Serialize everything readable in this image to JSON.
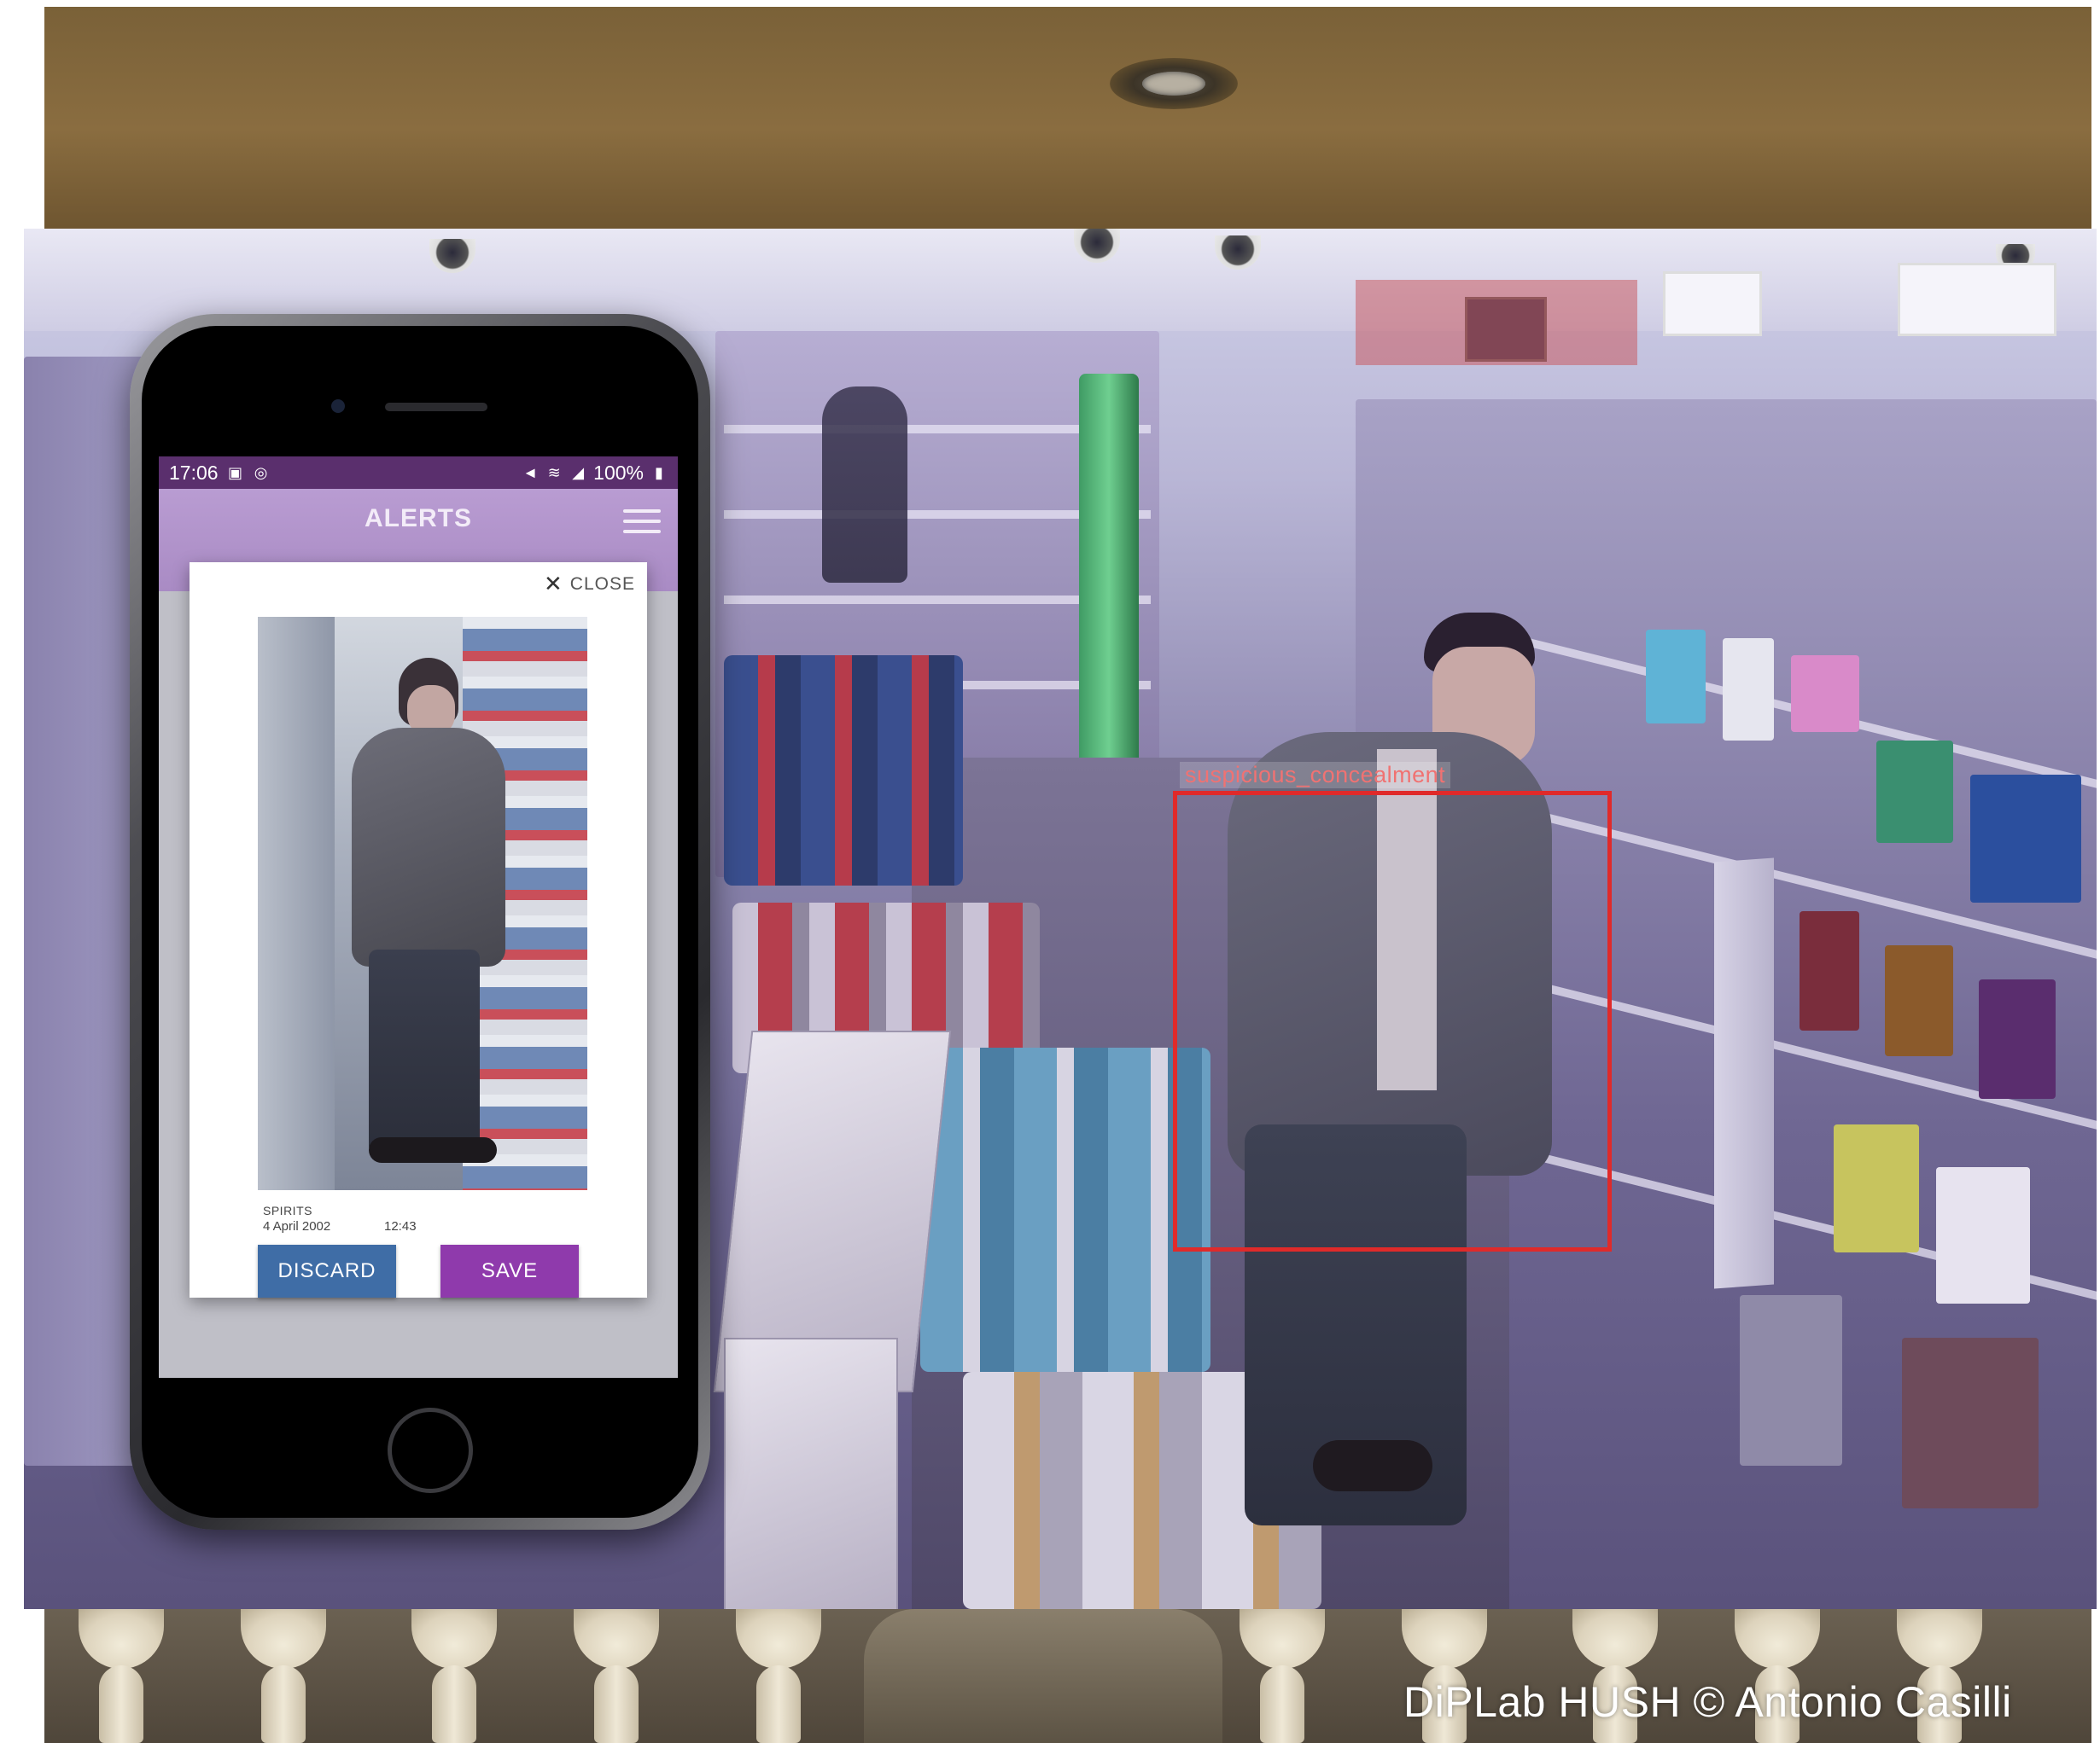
{
  "phone": {
    "status_bar": {
      "time": "17:06",
      "battery": "100%",
      "left_icons": [
        "image-icon",
        "sync-icon"
      ],
      "right_icons": [
        "mute-icon",
        "wifi-icon",
        "signal-icon",
        "battery-icon"
      ]
    },
    "app": {
      "title": "ALERTS",
      "menu_icon": "hamburger-menu-icon"
    },
    "dialog": {
      "close_label": "CLOSE",
      "close_icon": "close-icon",
      "category": "SPIRITS",
      "date": "4 April 2002",
      "time": "12:43",
      "discard_label": "DISCARD",
      "save_label": "SAVE"
    }
  },
  "overlay": {
    "detection_label": "suspicious_concealment"
  },
  "credit": "DiPLab HUSH © Antonio Casilli",
  "colors": {
    "status_bar": "#5a2f6d",
    "app_bar": "#a98bc4",
    "discard_button": "#3f6da6",
    "save_button": "#8f3aac",
    "detection_box": "#e02a2a"
  }
}
